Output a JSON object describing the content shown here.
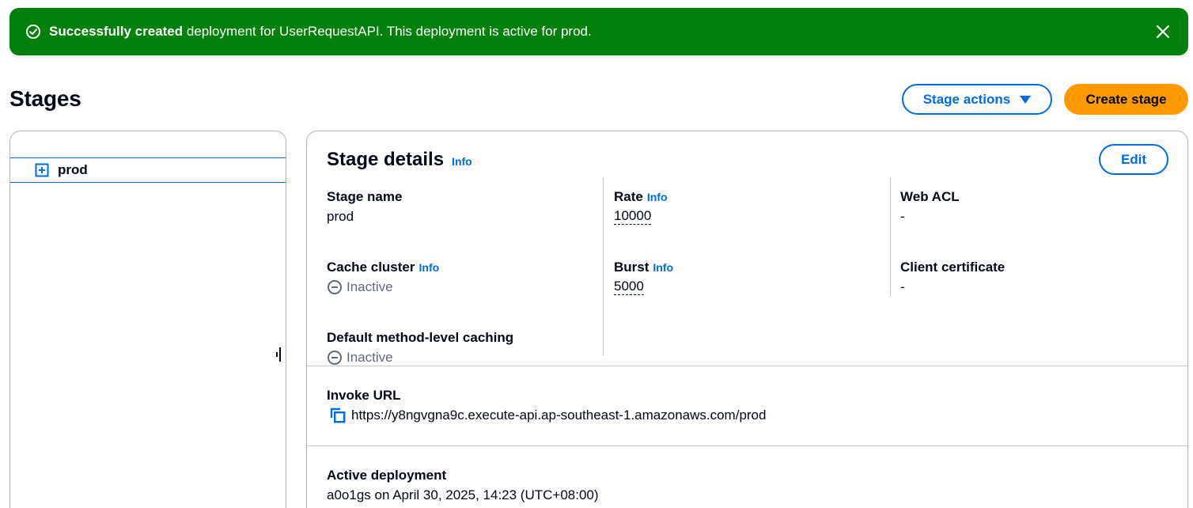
{
  "flash": {
    "strong": "Successfully created",
    "message": " deployment for UserRequestAPI. This deployment is active for prod.",
    "icon": "check-circle-icon",
    "color": "#037f0c"
  },
  "header": {
    "title": "Stages",
    "stage_actions_label": "Stage actions",
    "create_stage_label": "Create stage"
  },
  "tree": {
    "items": [
      {
        "label": "prod"
      }
    ]
  },
  "details": {
    "title": "Stage details",
    "info": "Info",
    "edit_label": "Edit",
    "stage_name": {
      "label": "Stage name",
      "value": "prod"
    },
    "cache_cluster": {
      "label": "Cache cluster",
      "info": "Info",
      "value": "Inactive"
    },
    "default_caching": {
      "label": "Default method-level caching",
      "value": "Inactive"
    },
    "rate": {
      "label": "Rate",
      "info": "Info",
      "value": "10000"
    },
    "burst": {
      "label": "Burst",
      "info": "Info",
      "value": "5000"
    },
    "web_acl": {
      "label": "Web ACL",
      "value": "-"
    },
    "client_certificate": {
      "label": "Client certificate",
      "value": "-"
    },
    "invoke_url": {
      "label": "Invoke URL",
      "value": "https://y8ngvgna9c.execute-api.ap-southeast-1.amazonaws.com/prod"
    },
    "active_deployment": {
      "label": "Active deployment",
      "value": "a0o1gs on April 30, 2025, 14:23 (UTC+08:00)"
    }
  },
  "colors": {
    "accent": "#006ce0",
    "primary_button": "#ff9900",
    "success": "#037f0c"
  }
}
